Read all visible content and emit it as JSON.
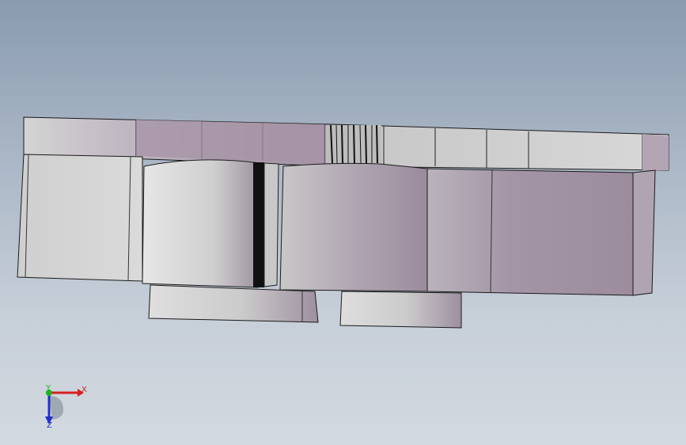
{
  "viewport": {
    "background_top": "#8a9bb0",
    "background_bottom": "#d3d9e0"
  },
  "triad": {
    "x_label": "X",
    "y_label": "Y",
    "z_label": "Z",
    "x_color": "#d42020",
    "y_color": "#22b022",
    "z_color": "#2030c8"
  },
  "model": {
    "light_face": "#d6d6d6",
    "tinted_face": "#a896a8",
    "edge_color": "#1a1a1a"
  }
}
